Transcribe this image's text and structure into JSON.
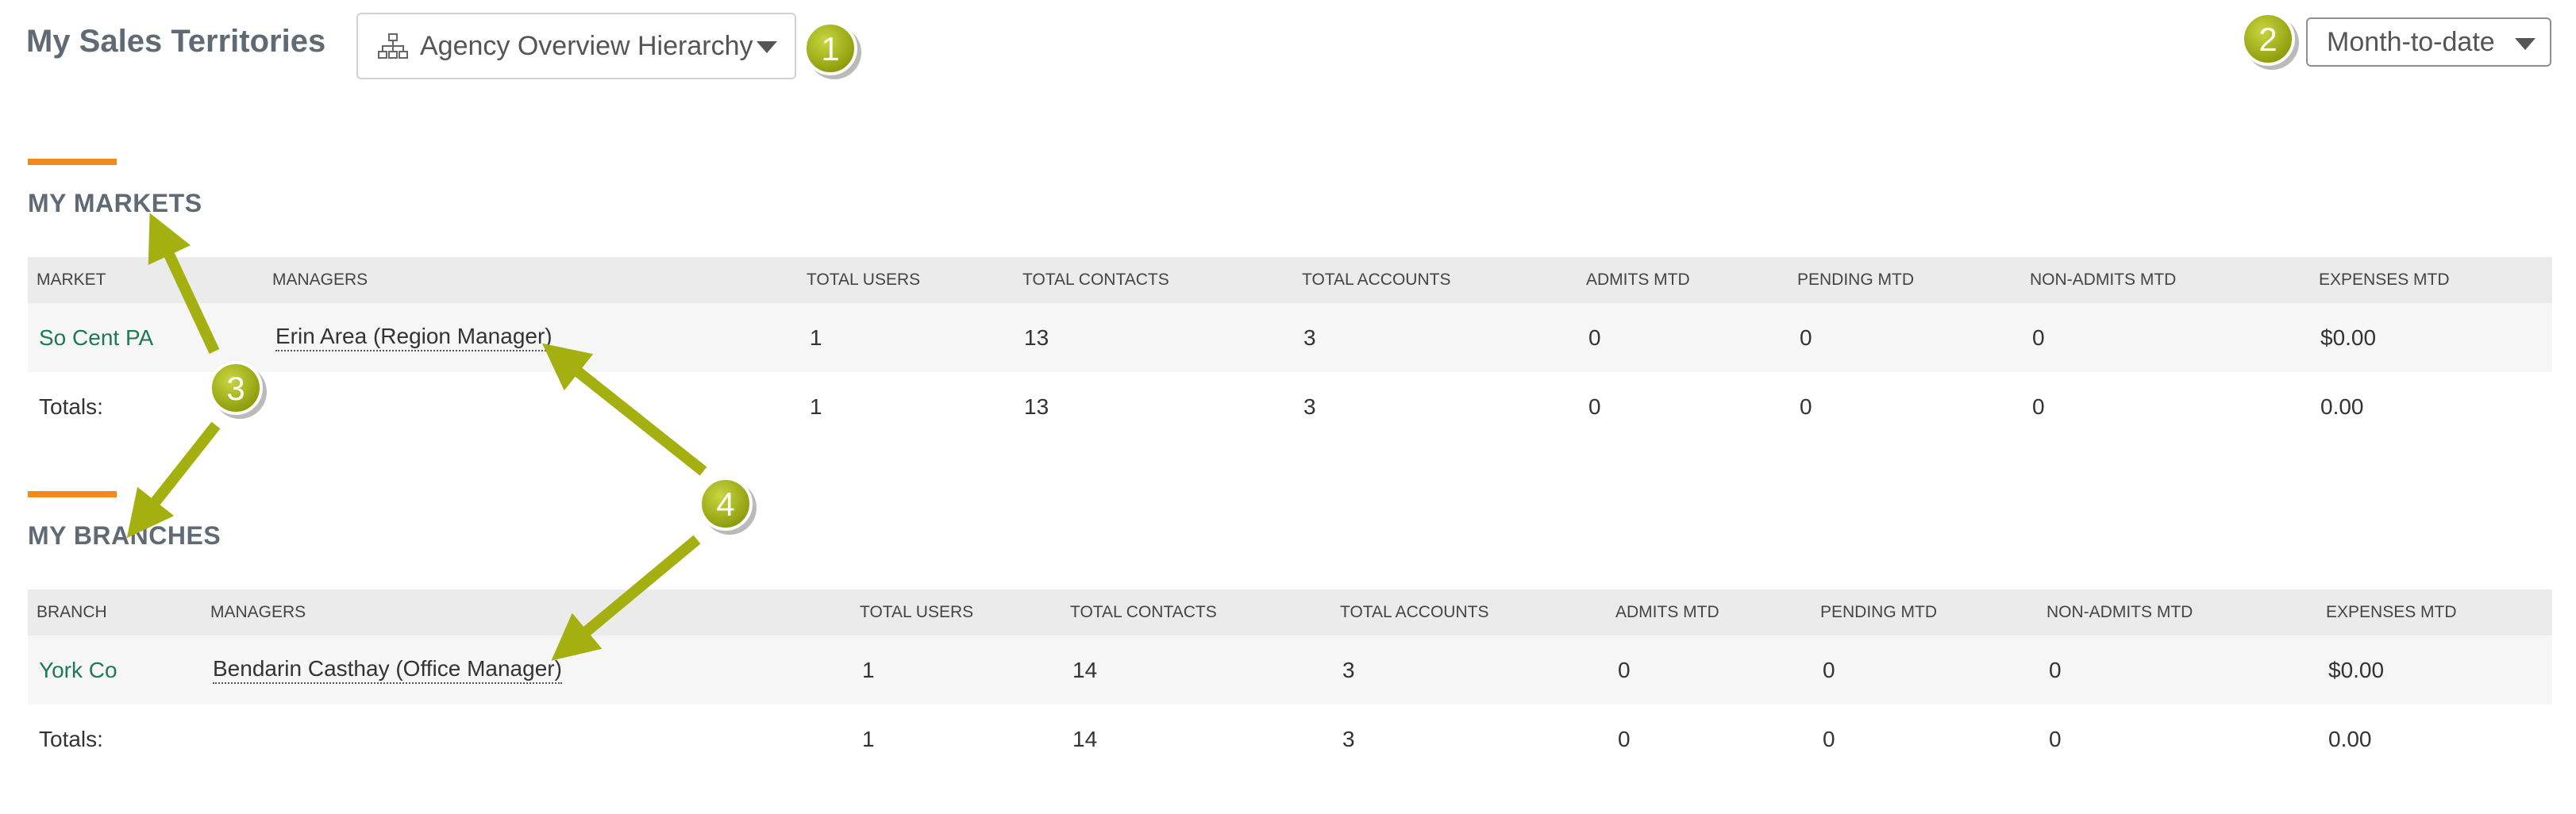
{
  "header": {
    "title": "My Sales Territories",
    "hierarchy_select": {
      "selected": "Agency Overview Hierarchy",
      "icon": "org-chart-icon"
    },
    "period_select": {
      "selected": "Month-to-date"
    }
  },
  "markets": {
    "title": "MY MARKETS",
    "columns": [
      "MARKET",
      "MANAGERS",
      "TOTAL USERS",
      "TOTAL CONTACTS",
      "TOTAL ACCOUNTS",
      "ADMITS MTD",
      "PENDING MTD",
      "NON-ADMITS MTD",
      "EXPENSES MTD"
    ],
    "rows": [
      {
        "name": "So Cent PA",
        "manager": "Erin Area (Region Manager)",
        "total_users": "1",
        "total_contacts": "13",
        "total_accounts": "3",
        "admits": "0",
        "pending": "0",
        "non_admits": "0",
        "expenses": "$0.00"
      }
    ],
    "totals": {
      "label": "Totals:",
      "total_users": "1",
      "total_contacts": "13",
      "total_accounts": "3",
      "admits": "0",
      "pending": "0",
      "non_admits": "0",
      "expenses": "0.00"
    }
  },
  "branches": {
    "title": "MY BRANCHES",
    "columns": [
      "BRANCH",
      "MANAGERS",
      "TOTAL USERS",
      "TOTAL CONTACTS",
      "TOTAL ACCOUNTS",
      "ADMITS MTD",
      "PENDING MTD",
      "NON-ADMITS MTD",
      "EXPENSES MTD"
    ],
    "rows": [
      {
        "name": "York Co",
        "manager": "Bendarin Casthay (Office Manager)",
        "total_users": "1",
        "total_contacts": "14",
        "total_accounts": "3",
        "admits": "0",
        "pending": "0",
        "non_admits": "0",
        "expenses": "$0.00"
      }
    ],
    "totals": {
      "label": "Totals:",
      "total_users": "1",
      "total_contacts": "14",
      "total_accounts": "3",
      "admits": "0",
      "pending": "0",
      "non_admits": "0",
      "expenses": "0.00"
    }
  },
  "annotations": {
    "color": "#a4b010",
    "badges": [
      "1",
      "2",
      "3",
      "4"
    ]
  }
}
